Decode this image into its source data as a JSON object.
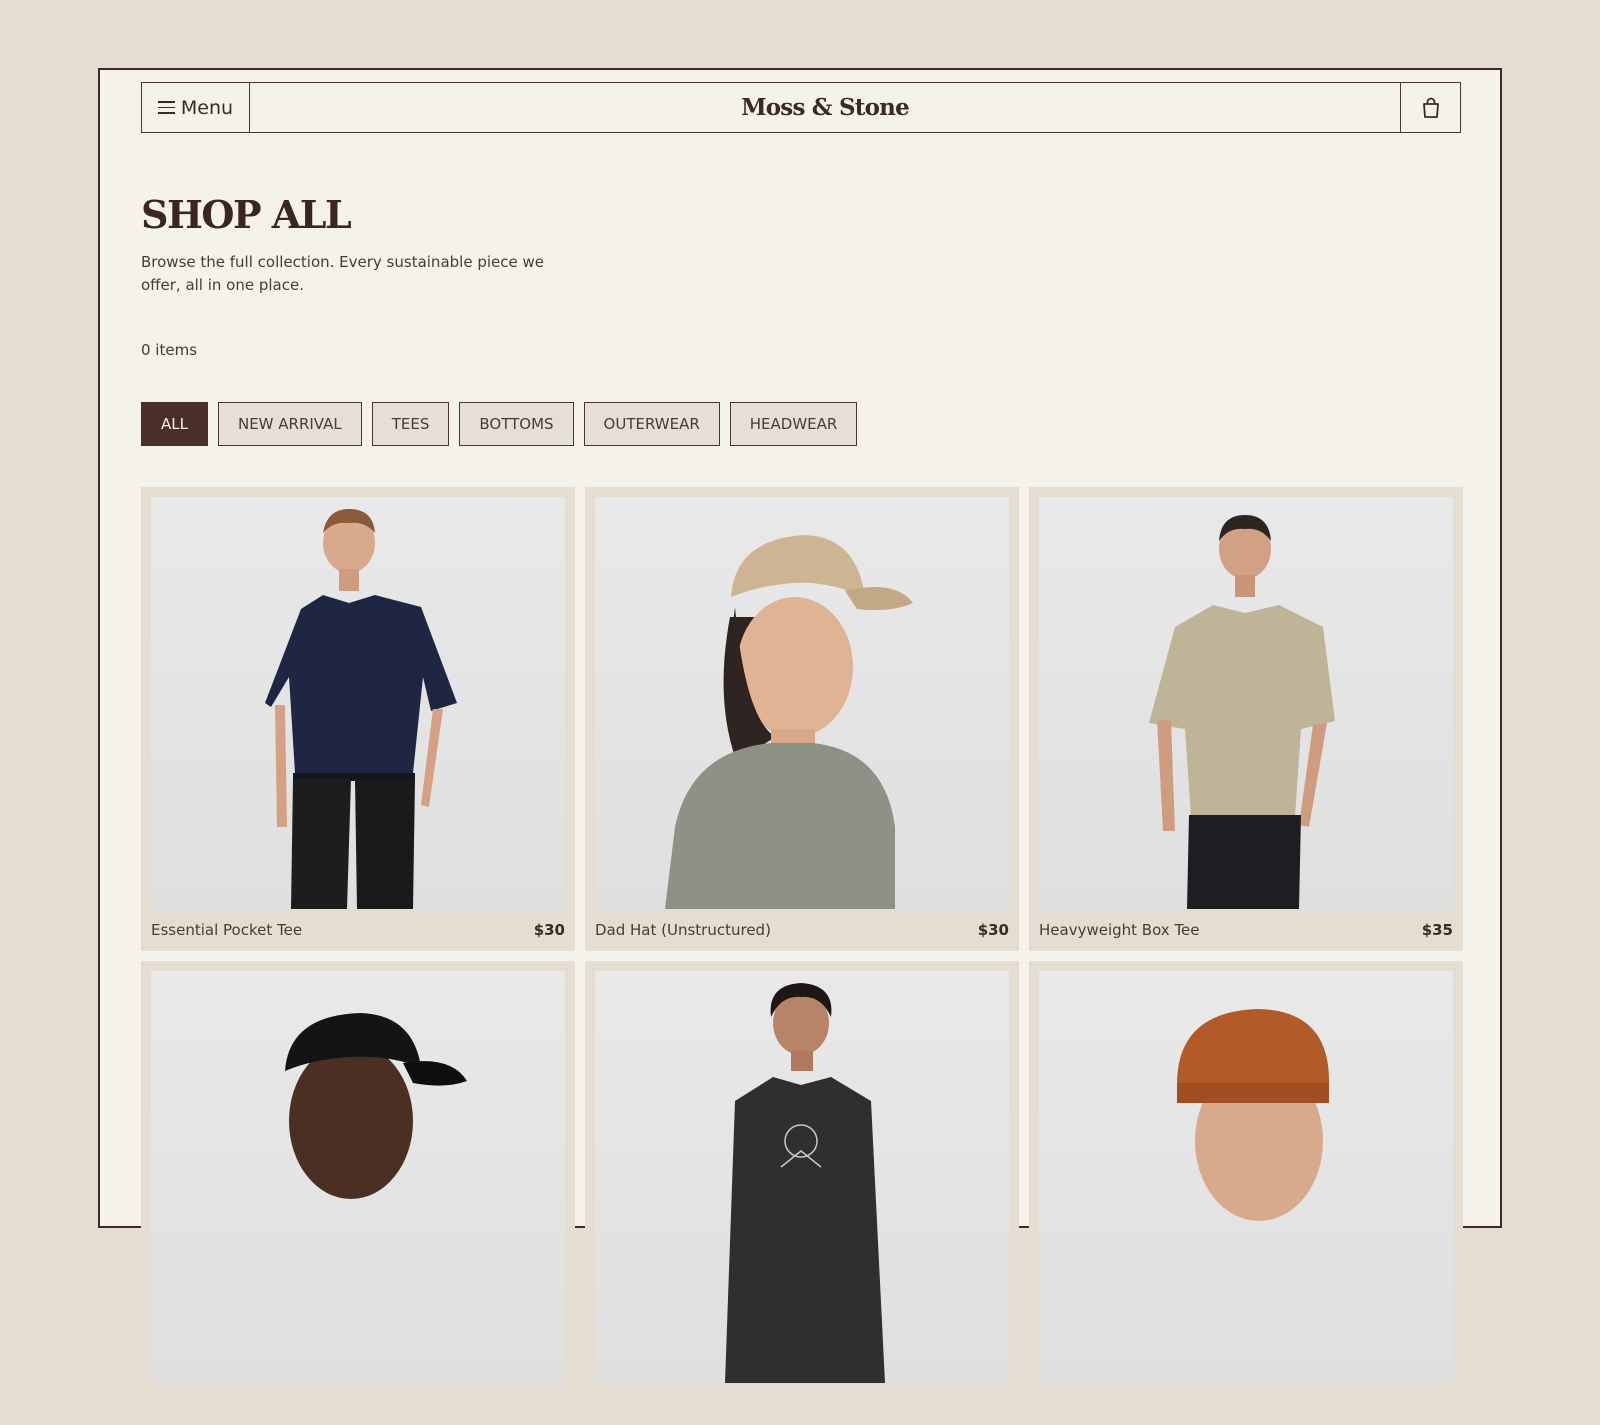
{
  "header": {
    "menu_label": "Menu",
    "brand": "Moss & Stone"
  },
  "page": {
    "title": "SHOP ALL",
    "description": "Browse the full collection. Every sustainable piece we offer, all in one place.",
    "item_count": "0 items"
  },
  "filters": [
    {
      "label": "ALL",
      "active": true
    },
    {
      "label": "NEW ARRIVAL",
      "active": false
    },
    {
      "label": "TEES",
      "active": false
    },
    {
      "label": "BOTTOMS",
      "active": false
    },
    {
      "label": "OUTERWEAR",
      "active": false
    },
    {
      "label": "HEADWEAR",
      "active": false
    }
  ],
  "products": [
    {
      "name": "Essential Pocket Tee",
      "price": "$30"
    },
    {
      "name": "Dad Hat (Unstructured)",
      "price": "$30"
    },
    {
      "name": "Heavyweight Box Tee",
      "price": "$35"
    },
    {
      "name": "",
      "price": ""
    },
    {
      "name": "",
      "price": ""
    },
    {
      "name": "",
      "price": ""
    }
  ],
  "colors": {
    "accent": "#4a2e28",
    "background": "#e5ddd2",
    "surface": "#f5f2ec"
  }
}
